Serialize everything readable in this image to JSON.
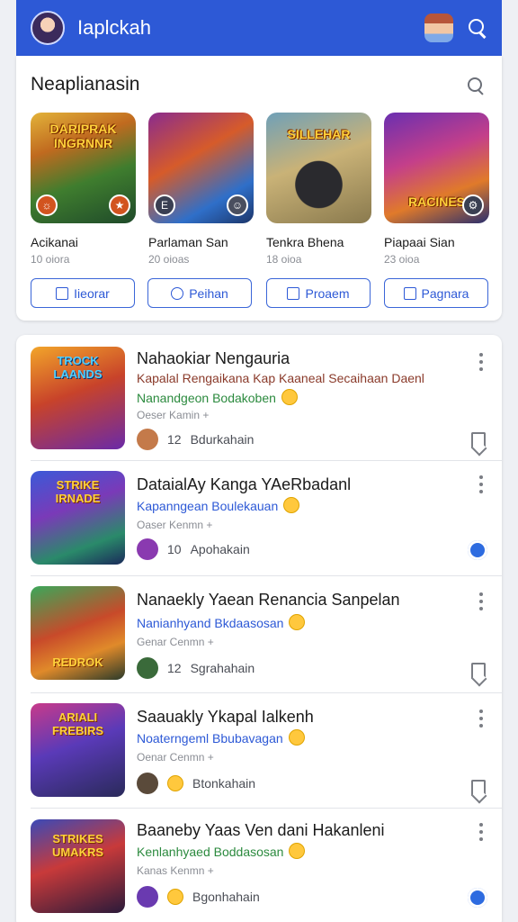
{
  "app": {
    "title": "Iaplckah"
  },
  "featured": {
    "title": "Neaplianasin",
    "tiles": [
      {
        "art_text": "DARIPRAK INGRNNR",
        "name": "Acikanai",
        "meta": "10 oiora",
        "badge_left": "☼",
        "badge_right": "★"
      },
      {
        "art_text": "",
        "name": "Parlaman San",
        "meta": "20 oioas",
        "badge_left": "E",
        "badge_right": "☺"
      },
      {
        "art_text": "SILLEHAR",
        "name": "Tenkra Bhena",
        "meta": "18 oioa",
        "badge_left": "",
        "badge_right": ""
      },
      {
        "art_text": "RACINES",
        "name": "Piapaai Sian",
        "meta": "23 oioa",
        "badge_left": "",
        "badge_right": "⚙"
      }
    ],
    "buttons": [
      {
        "label": "Iieorar"
      },
      {
        "label": "Peihan"
      },
      {
        "label": "Proaem"
      },
      {
        "label": "Pagnara"
      }
    ]
  },
  "list": [
    {
      "art_text": "TROCK LAANDS",
      "title": "Nahaokiar Nengauria",
      "desc": "Kapalal Rengaikana Kap Kaaneal Secaihaan Daenl",
      "sub": "Nanandgeon Bodakoben",
      "genre": "Oeser Kamin +",
      "count": "12",
      "footer_label": "Bdurkahain",
      "action": "bookmark"
    },
    {
      "art_text": "STRIKE IRNADE",
      "title": "DataialAy Kanga YAeRbadanl",
      "desc": "",
      "sub": "Kapanngean Boulekauan",
      "genre": "Oaser Kenmn +",
      "count": "10",
      "footer_label": "Apohakain",
      "action": "gear"
    },
    {
      "art_text": "REDROK",
      "title": "Nanaekly Yaean Renancia Sanpelan",
      "desc": "",
      "sub": "Nanianhyand Bkdaasosan",
      "genre": "Genar Cenmn +",
      "count": "12",
      "footer_label": "Sgrahahain",
      "action": "bookmark"
    },
    {
      "art_text": "ARIALI FREBIRS",
      "title": "Saauakly Ykapal Ialkenh",
      "desc": "",
      "sub": "Noaterngeml Bbubavagan",
      "genre": "Oenar Cenmn +",
      "count": "",
      "footer_label": "Btonkahain",
      "action": "bookmark"
    },
    {
      "art_text": "STRIKES UMAKRS",
      "title": "Baaneby Yaas Ven dani Hakanleni",
      "desc": "",
      "sub": "Kenlanhyaed Boddasosan",
      "genre": "Kanas Kenmn +",
      "count": "",
      "footer_label": "Bgonhahain",
      "action": "gear"
    }
  ]
}
